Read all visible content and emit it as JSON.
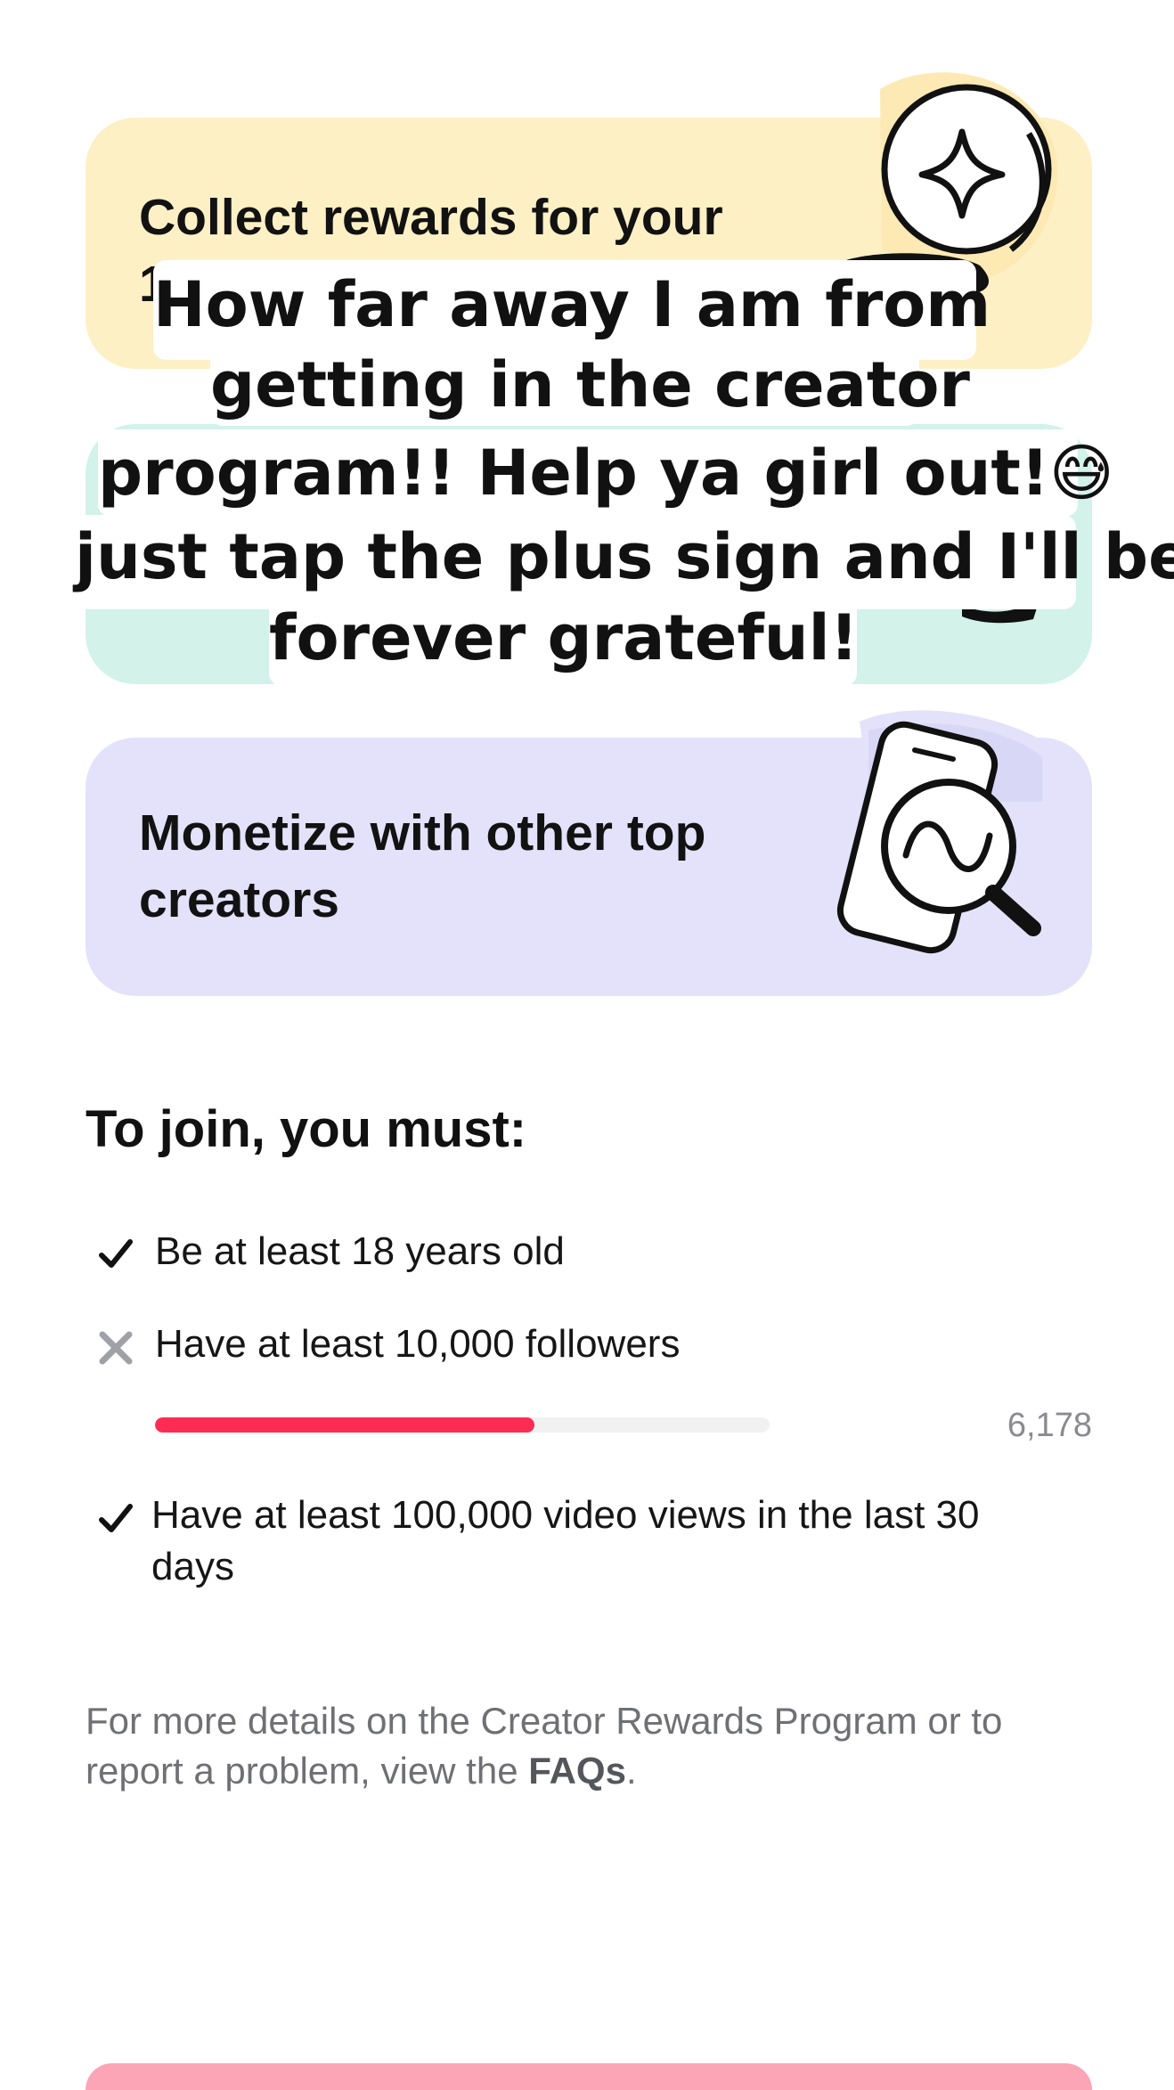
{
  "cards": {
    "rewards": {
      "title_line1": "Collect rewards for your",
      "title_line2_fragment": "1",
      "color": "#fdf0c5"
    },
    "mint": {
      "color": "#d2f2ea"
    },
    "monetize": {
      "title_line1": "Monetize with other top",
      "title_line2": "creators",
      "color": "#e3e2fa"
    }
  },
  "overlay": {
    "lines": [
      "How far away I am from",
      "getting in the creator",
      "program!! Help ya girl out!😅",
      "just tap the plus sign and I'll be",
      "forever grateful!"
    ]
  },
  "requirements": {
    "title": "To join, you must:",
    "items": [
      {
        "text": "Be at least 18 years old",
        "status": "met",
        "icon": "check-icon"
      },
      {
        "text": "Have at least 10,000 followers",
        "status": "not-met",
        "icon": "cross-icon"
      },
      {
        "text_line1": "Have at least 100,000 video views in the last 30",
        "text_line2": "days",
        "status": "met",
        "icon": "check-icon"
      }
    ],
    "followers_progress": {
      "current_label": "6,178",
      "current": 6178,
      "target": 10000,
      "fill_color": "#fe2c55"
    }
  },
  "footer": {
    "line1": "For more details on the Creator Rewards Program or to",
    "line2_prefix": "report a problem, view the ",
    "faq_link": "FAQs",
    "line2_suffix": "."
  },
  "cta": {
    "color": "#fca5b6"
  }
}
